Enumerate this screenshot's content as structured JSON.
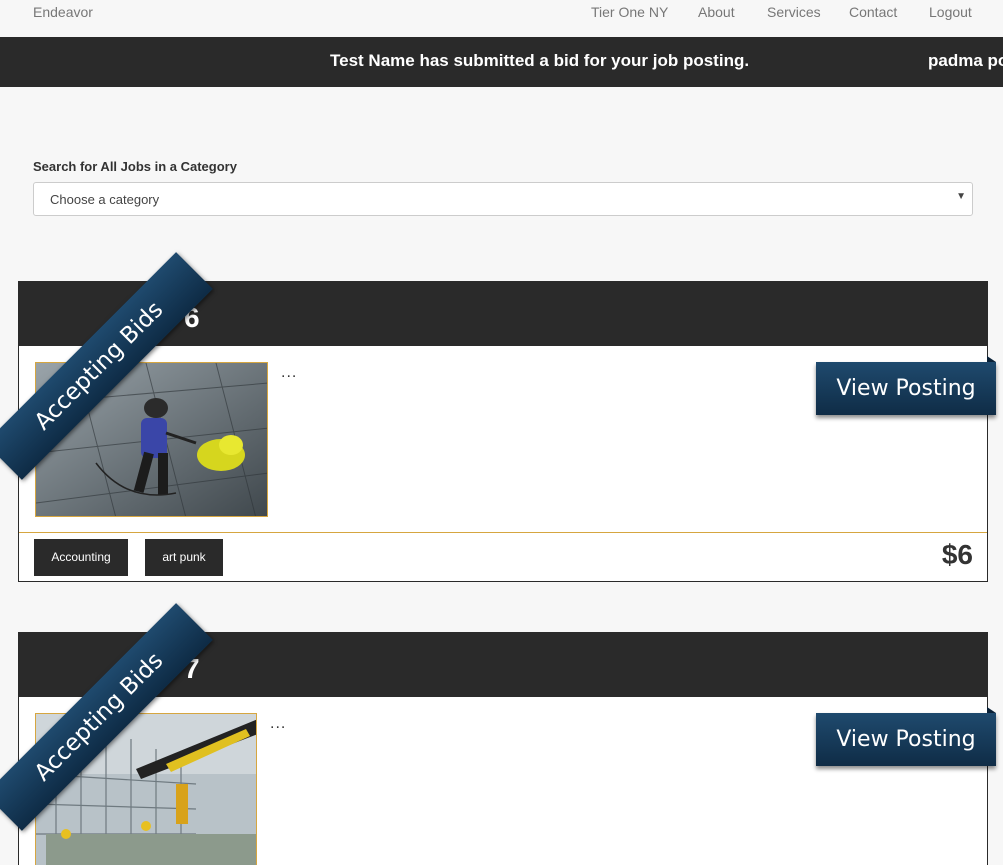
{
  "nav": {
    "brand": "Endeavor",
    "links": [
      "Tier One NY",
      "About",
      "Services",
      "Contact",
      "Logout"
    ]
  },
  "ticker": {
    "message1": "Test Name has submitted a bid for your job posting.",
    "message2": "padma po"
  },
  "search": {
    "label": "Search for All Jobs in a Category",
    "selected": "Choose a category"
  },
  "jobs": [
    {
      "ribbon": "Accepting Bids",
      "number": "6",
      "description": "...",
      "view_label": "View Posting",
      "tags": [
        "Accounting",
        "art punk"
      ],
      "price": "$6"
    },
    {
      "ribbon": "Accepting Bids",
      "number": "7",
      "description": "...",
      "view_label": "View Posting"
    }
  ]
}
